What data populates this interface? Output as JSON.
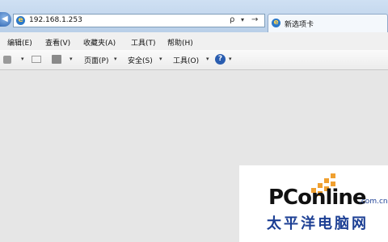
{
  "address_bar": {
    "url": "192.168.1.253",
    "search_glyph": "ρ",
    "caret_glyph": "▾",
    "go_glyph": "→"
  },
  "tab": {
    "title": "新选项卡"
  },
  "menubar": {
    "items": [
      "编辑(E)",
      "查看(V)",
      "收藏夹(A)",
      "工具(T)",
      "帮助(H)"
    ]
  },
  "command_bar": {
    "page": "页面(P)",
    "safety": "安全(S)",
    "tools": "工具(O)",
    "dropdown_glyph": "▾",
    "help_glyph": "?"
  },
  "watermark": {
    "brand_main": "PConline",
    "brand_suffix": ".com.cn",
    "brand_cn": "太平洋电脑网",
    "accent": "#f0a030",
    "brand_color": "#1c3f94"
  }
}
